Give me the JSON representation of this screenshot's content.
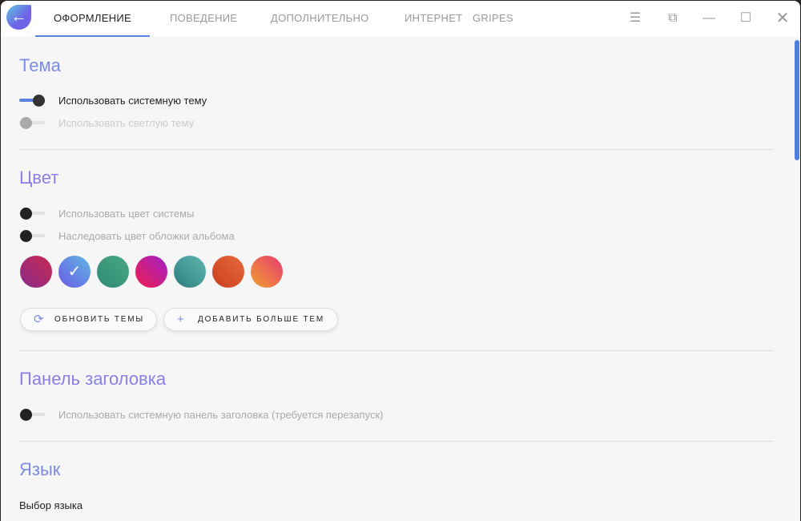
{
  "tabs": [
    "ОФОРМЛЕНИЕ",
    "ПОВЕДЕНИЕ",
    "ДОПОЛНИТЕЛЬНО",
    "ИНТЕРНЕТ",
    "GRIPES"
  ],
  "sections": {
    "theme": {
      "title": "Тема",
      "system": "Использовать системную тему",
      "light": "Использовать светлую тему"
    },
    "color": {
      "title": "Цвет",
      "system": "Использовать цвет системы",
      "album": "Наследовать цвет обложки альбома",
      "swatches": [
        "#a42a6a",
        "#6b6ee8",
        "#3a9a7e",
        "#d0206a",
        "#3a9690",
        "#d5502a",
        "#e8703a"
      ],
      "refresh": "ОБНОВИТЬ ТЕМЫ",
      "add": "ДОБАВИТЬ БОЛЬШЕ ТЕМ"
    },
    "titlebar": {
      "title": "Панель заголовка",
      "system": "Использовать системную панель заголовка (требуется перезапуск)"
    },
    "language": {
      "title": "Язык",
      "select": "Выбор языка"
    }
  },
  "accent": "#5b84e0"
}
